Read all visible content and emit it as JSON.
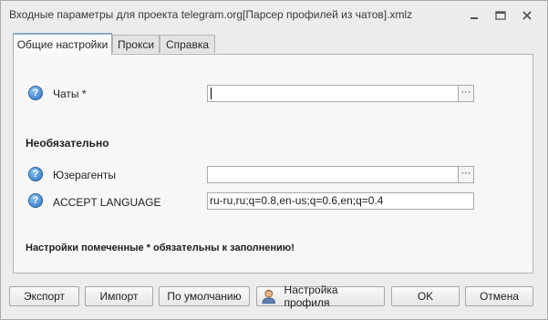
{
  "window": {
    "title": "Входные параметры для проекта telegram.org[Парсер профилей из чатов].xmlz",
    "minimize_icon": "minimize-icon",
    "maximize_icon": "maximize-icon",
    "close_icon": "close-icon"
  },
  "tabs": [
    {
      "label": "Общие настройки",
      "active": true
    },
    {
      "label": "Прокси",
      "active": false
    },
    {
      "label": "Справка",
      "active": false
    }
  ],
  "form": {
    "help_glyph": "?",
    "chats": {
      "label": "Чаты *",
      "value": "",
      "browse": "···"
    },
    "optional_header": "Необязательно",
    "user_agents": {
      "label": "Юзерагенты",
      "value": "",
      "browse": "···"
    },
    "accept_language": {
      "label": "ACCEPT LANGUAGE",
      "value": "ru-ru,ru;q=0.8,en-us;q=0.6,en;q=0.4"
    },
    "note": "Настройки помеченные * обязательны к заполнению!"
  },
  "footer": {
    "export": "Экспорт",
    "import": "Импорт",
    "defaults": "По умолчанию",
    "profile": "Настройка профиля",
    "profile_icon": "user-profile-icon",
    "ok": "OK",
    "cancel": "Отмена"
  },
  "colors": {
    "window_bg": "#ececec",
    "panel_bg": "#f7f7f7",
    "help_icon": "#2f74c3",
    "active_tab_accent": "#8ea8c8"
  }
}
